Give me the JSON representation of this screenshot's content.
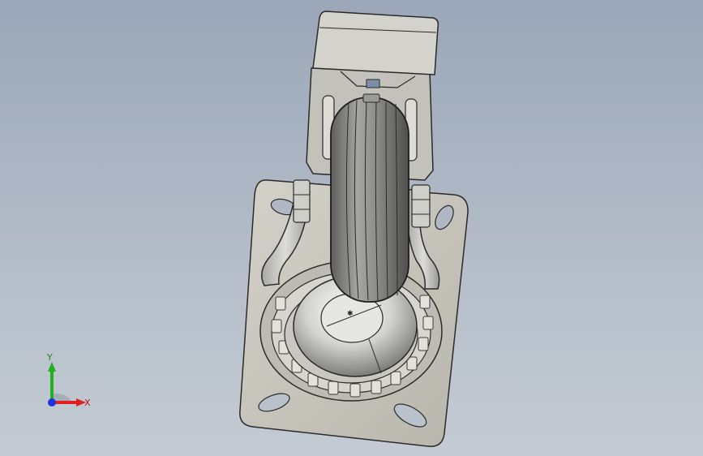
{
  "viewport": {
    "background_top": "#9ba7b8",
    "background_bottom": "#c4cbd4"
  },
  "triad": {
    "x_label": "X",
    "y_label": "Y",
    "x_color": "#e0201c",
    "y_color": "#20b020",
    "z_color": "#2030e0"
  },
  "model": {
    "part": "swivel-caster-wheel",
    "plate_color": "#c9c7bd",
    "metal_color": "#d8d8d4",
    "tire_color": "#8e8e8c",
    "edge_color": "#2a2a2a"
  }
}
